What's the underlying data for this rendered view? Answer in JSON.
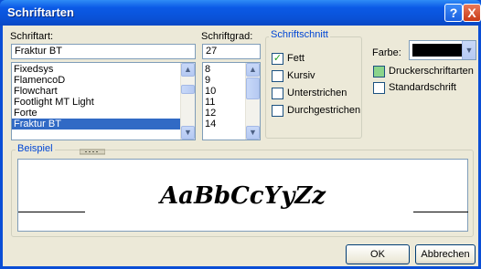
{
  "window": {
    "title": "Schriftarten",
    "help_glyph": "?",
    "close_glyph": "X"
  },
  "font": {
    "label": "Schriftart:",
    "value": "Fraktur BT",
    "items": [
      "Fixedsys",
      "FlamencoD",
      "Flowchart",
      "Footlight MT Light",
      "Forte",
      "Fraktur BT"
    ],
    "selected_index": 5
  },
  "size": {
    "label": "Schriftgrad:",
    "value": "27",
    "items": [
      "8",
      "9",
      "10",
      "11",
      "12",
      "14"
    ]
  },
  "style": {
    "group_title": "Schriftschnitt",
    "options": [
      {
        "label": "Fett",
        "checked": true
      },
      {
        "label": "Kursiv",
        "checked": false
      },
      {
        "label": "Unterstrichen",
        "checked": false
      },
      {
        "label": "Durchgestrichen",
        "checked": false
      }
    ]
  },
  "color": {
    "label": "Farbe:",
    "value_hex": "#000000"
  },
  "extra": {
    "printer_fonts": {
      "label": "Druckerschriftarten",
      "checked": true
    },
    "default_font": {
      "label": "Standardschrift",
      "checked": false
    }
  },
  "preview": {
    "group_title": "Beispiel",
    "sample": "AaBbCcYyZz"
  },
  "buttons": {
    "ok": "OK",
    "cancel": "Abbrechen"
  },
  "icons": {
    "scroll_up": "scroll-up-arrow-icon",
    "scroll_down": "scroll-down-arrow-icon",
    "dropdown": "chevron-down-icon"
  }
}
